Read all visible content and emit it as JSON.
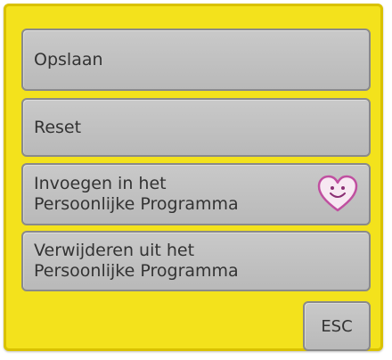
{
  "menu": {
    "items": [
      {
        "label": "Opslaan"
      },
      {
        "label": "Reset"
      },
      {
        "label": "Invoegen in het\nPersoonlijke Programma",
        "icon": "smiley-heart-icon",
        "icon_color": "#c04fa0"
      },
      {
        "label": "Verwijderen uit het\nPersoonlijke Programma"
      }
    ],
    "esc_label": "ESC"
  },
  "colors": {
    "panel_background": "#f3e21c",
    "button_background": "#c2c2c2"
  }
}
